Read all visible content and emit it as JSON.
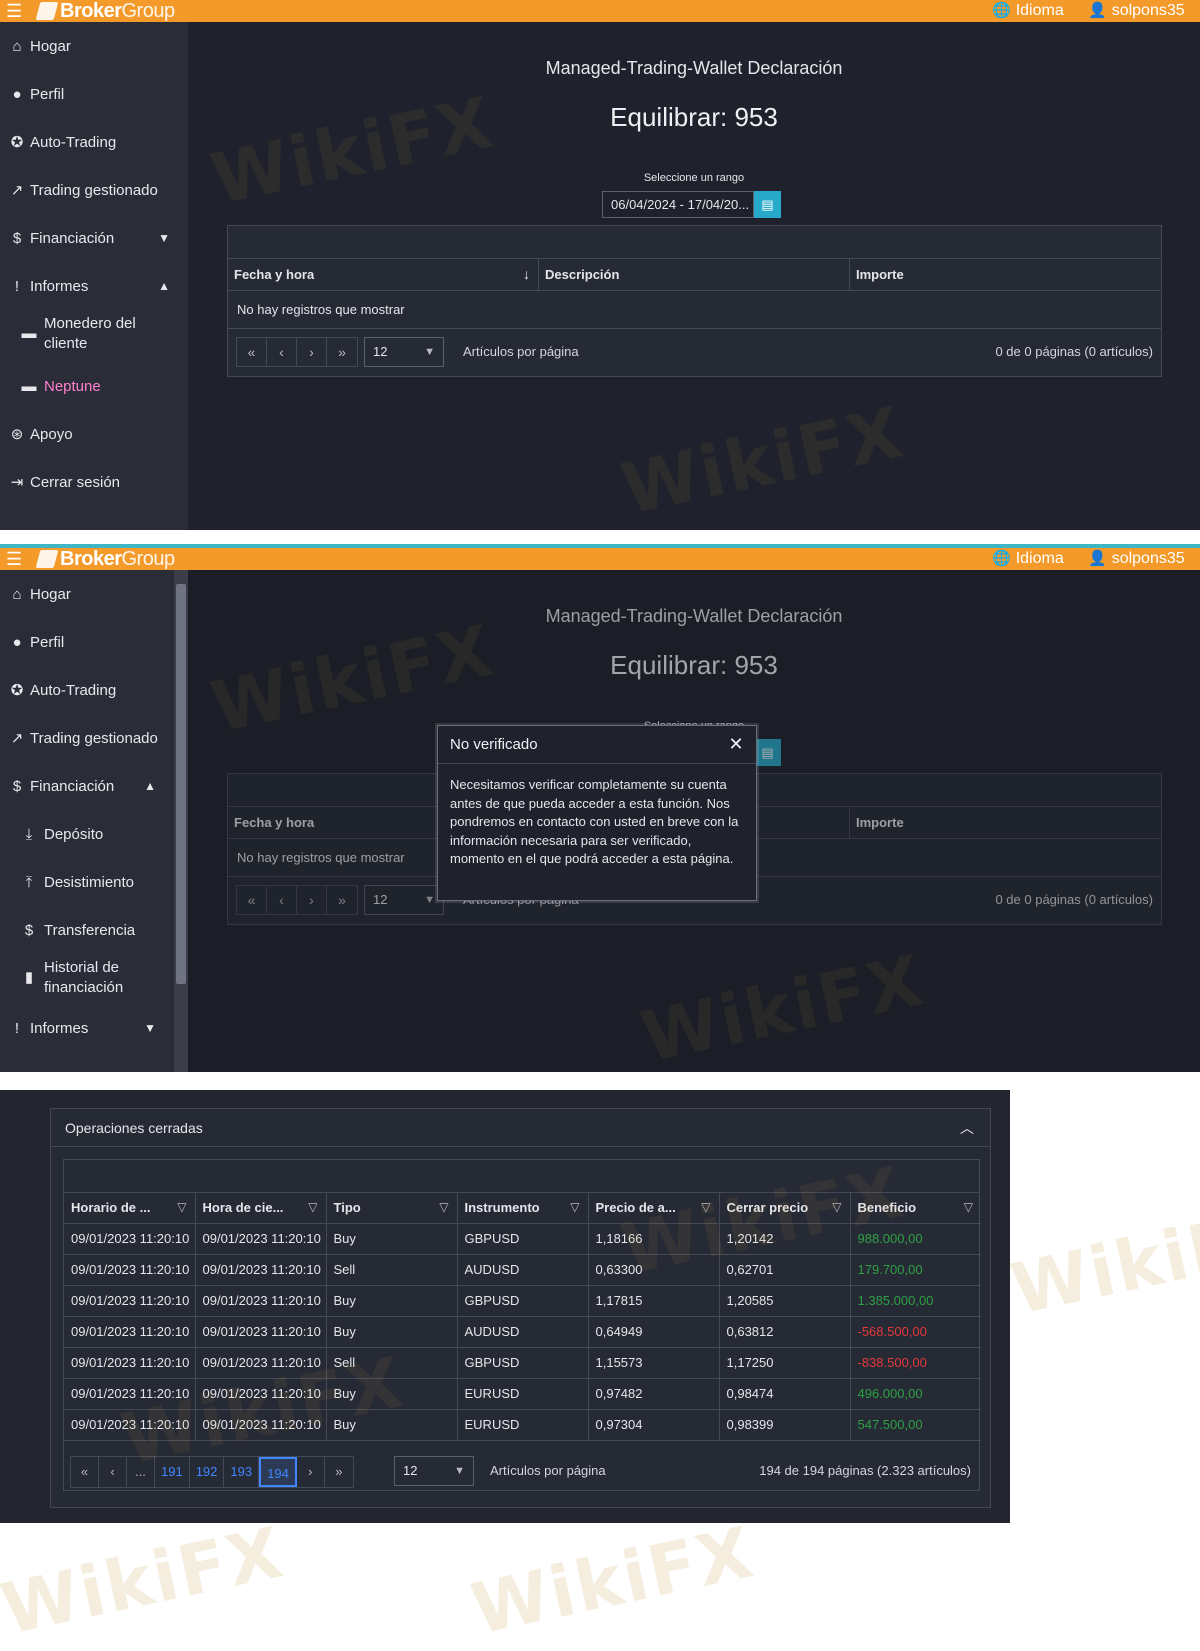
{
  "brand": {
    "name_bold": "Broker",
    "name_light": "Group"
  },
  "topbar": {
    "language": "Idioma",
    "username": "solpons35"
  },
  "colors": {
    "accent": "#f39a2a",
    "positive": "#2ea043",
    "negative": "#e5383b",
    "active_menu": "#ff7fd0",
    "calendar_button": "#27a9c9",
    "current_page": "#3f86ff"
  },
  "panel1": {
    "sidebar": [
      {
        "label": "Hogar",
        "icon": "home-icon"
      },
      {
        "label": "Perfil",
        "icon": "user-icon"
      },
      {
        "label": "Auto-Trading",
        "icon": "robot-icon"
      },
      {
        "label": "Trading gestionado",
        "icon": "trend-icon"
      },
      {
        "label": "Financiación",
        "icon": "money-icon"
      },
      {
        "label": "Informes",
        "icon": "info-icon"
      },
      {
        "label": "Monedero del cliente",
        "icon": "wallet-icon"
      },
      {
        "label": "Neptune",
        "icon": "wallet-icon"
      },
      {
        "label": "Apoyo",
        "icon": "support-icon"
      },
      {
        "label": "Cerrar sesión",
        "icon": "logout-icon"
      }
    ],
    "title": "Managed-Trading-Wallet Declaración",
    "balance": "Equilibrar: 953",
    "range_label": "Seleccione un rango",
    "range_value": "06/04/2024 - 17/04/20...",
    "columns": [
      "Fecha y hora",
      "Descripción",
      "Importe"
    ],
    "empty": "No hay registros que mostrar",
    "page_size": "12",
    "per_page_label": "Artículos por página",
    "page_info": "0 de 0 páginas (0 artículos)"
  },
  "panel2": {
    "sidebar": [
      {
        "label": "Hogar",
        "icon": "home-icon"
      },
      {
        "label": "Perfil",
        "icon": "user-icon"
      },
      {
        "label": "Auto-Trading",
        "icon": "robot-icon"
      },
      {
        "label": "Trading gestionado",
        "icon": "trend-icon"
      },
      {
        "label": "Financiación",
        "icon": "money-icon"
      },
      {
        "label": "Depósito",
        "icon": "download-icon"
      },
      {
        "label": "Desistimiento",
        "icon": "upload-icon"
      },
      {
        "label": "Transferencia",
        "icon": "transfer-icon"
      },
      {
        "label": "Historial de financiación",
        "icon": "file-icon"
      },
      {
        "label": "Informes",
        "icon": "info-icon"
      }
    ],
    "modal_title": "No verificado",
    "modal_body": "Necesitamos verificar completamente su cuenta antes de que pueda acceder a esta función. Nos pondremos en contacto con usted en breve con la información necesaria para ser verificado, momento en el que podrá acceder a esta página."
  },
  "panel3": {
    "card_title": "Operaciones cerradas",
    "columns": [
      "Horario de ...",
      "Hora de cie...",
      "Tipo",
      "Instrumento",
      "Precio de a...",
      "Cerrar precio",
      "Beneficio"
    ],
    "rows": [
      {
        "open": "09/01/2023 11:20:10",
        "close": "09/01/2023 11:20:10",
        "type": "Buy",
        "instrument": "GBPUSD",
        "open_price": "1,18166",
        "close_price": "1,20142",
        "profit": "988.000,00",
        "sign": "pos"
      },
      {
        "open": "09/01/2023 11:20:10",
        "close": "09/01/2023 11:20:10",
        "type": "Sell",
        "instrument": "AUDUSD",
        "open_price": "0,63300",
        "close_price": "0,62701",
        "profit": "179.700,00",
        "sign": "pos"
      },
      {
        "open": "09/01/2023 11:20:10",
        "close": "09/01/2023 11:20:10",
        "type": "Buy",
        "instrument": "GBPUSD",
        "open_price": "1,17815",
        "close_price": "1,20585",
        "profit": "1.385.000,00",
        "sign": "pos"
      },
      {
        "open": "09/01/2023 11:20:10",
        "close": "09/01/2023 11:20:10",
        "type": "Buy",
        "instrument": "AUDUSD",
        "open_price": "0,64949",
        "close_price": "0,63812",
        "profit": "-568.500,00",
        "sign": "neg"
      },
      {
        "open": "09/01/2023 11:20:10",
        "close": "09/01/2023 11:20:10",
        "type": "Sell",
        "instrument": "GBPUSD",
        "open_price": "1,15573",
        "close_price": "1,17250",
        "profit": "-838.500,00",
        "sign": "neg"
      },
      {
        "open": "09/01/2023 11:20:10",
        "close": "09/01/2023 11:20:10",
        "type": "Buy",
        "instrument": "EURUSD",
        "open_price": "0,97482",
        "close_price": "0,98474",
        "profit": "496.000,00",
        "sign": "pos"
      },
      {
        "open": "09/01/2023 11:20:10",
        "close": "09/01/2023 11:20:10",
        "type": "Buy",
        "instrument": "EURUSD",
        "open_price": "0,97304",
        "close_price": "0,98399",
        "profit": "547.500,00",
        "sign": "pos"
      }
    ],
    "pages": [
      "«",
      "‹",
      "...",
      "191",
      "192",
      "193",
      "194",
      "›",
      "»"
    ],
    "current_page": "194",
    "page_size": "12",
    "per_page_label": "Artículos por página",
    "page_info": "194 de 194 páginas (2.323 artículos)"
  },
  "watermark": "WikiFX"
}
